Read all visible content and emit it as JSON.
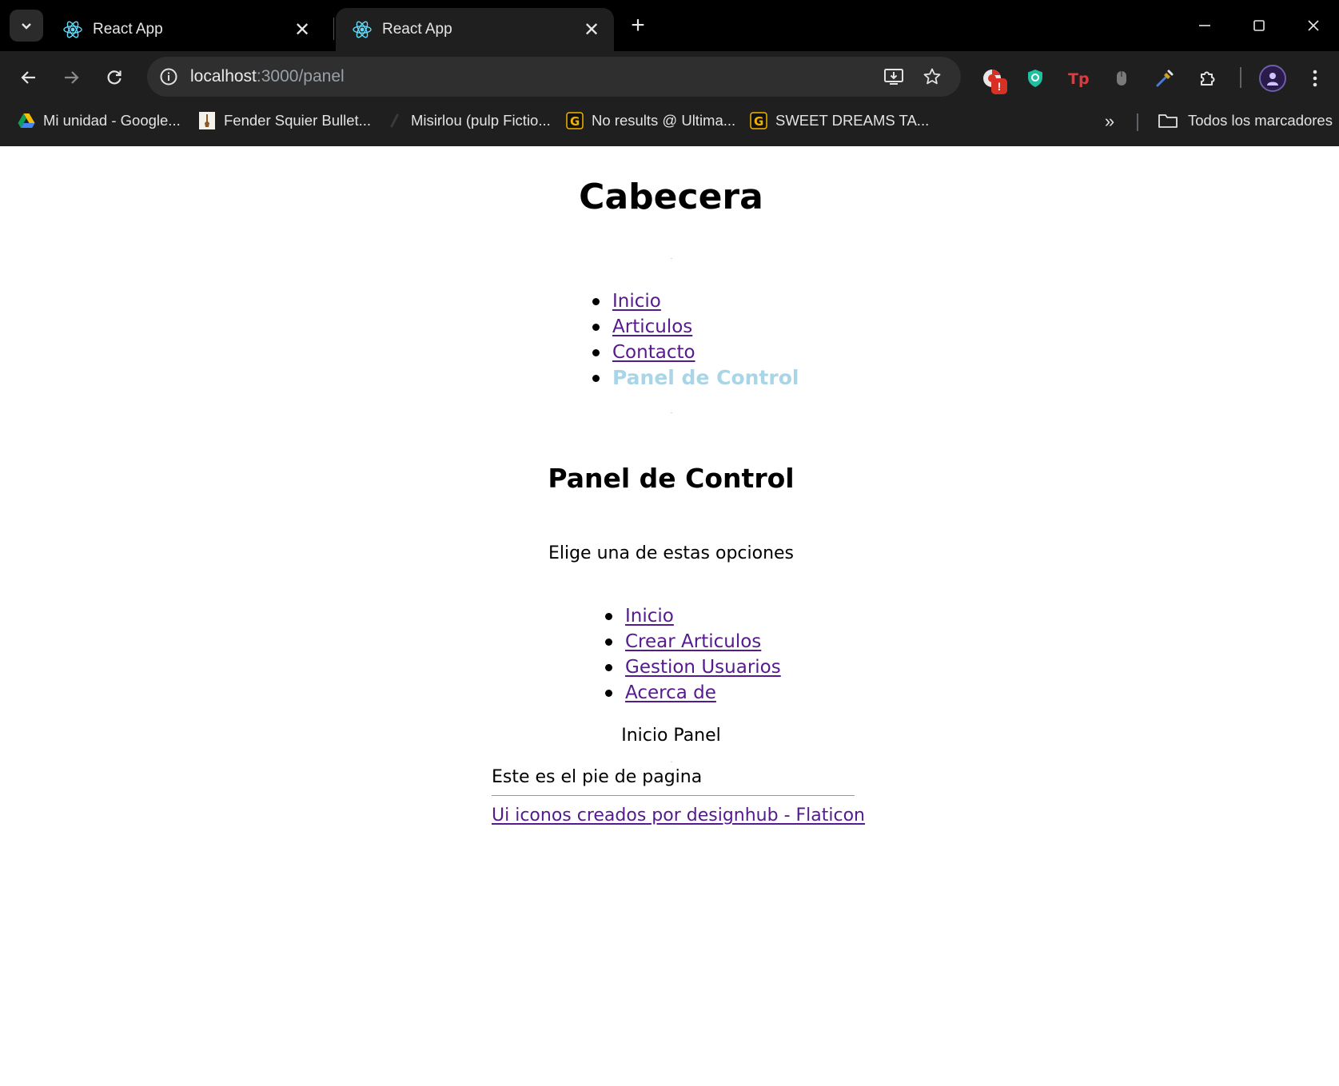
{
  "browser": {
    "tabs": [
      {
        "title": "React App",
        "favicon": "react-icon",
        "active": false
      },
      {
        "title": "React App",
        "favicon": "react-icon",
        "active": true
      }
    ],
    "tab_close": "✕",
    "new_tab": "+",
    "url": {
      "host": "localhost",
      "path": ":3000/panel"
    },
    "bookmarks": [
      {
        "label": "Mi unidad - Google...",
        "icon": "google-drive-icon"
      },
      {
        "label": "Fender Squier Bullet...",
        "icon": "guitar-thumbnail-icon"
      },
      {
        "label": "Misirlou (pulp Fictio...",
        "icon": "music-note-icon"
      },
      {
        "label": "No results @ Ultima...",
        "icon": "ultimate-guitar-icon"
      },
      {
        "label": "SWEET DREAMS TA...",
        "icon": "ultimate-guitar-icon"
      }
    ],
    "bookmarks_more": "»",
    "all_bookmarks": "Todos los marcadores",
    "extension_badge": "!"
  },
  "page": {
    "header_title": "Cabecera",
    "nav": [
      "Inicio",
      "Articulos",
      "Contacto",
      "Panel de Control"
    ],
    "active_nav_color": "#a9d5e6",
    "section_title": "Panel de Control",
    "subtitle": "Elige una de estas opciones",
    "panel_nav": [
      "Inicio",
      "Crear Articulos",
      "Gestion Usuarios",
      "Acerca de"
    ],
    "panel_content": "Inicio Panel",
    "footer_text": "Este es el pie de pagina",
    "footer_link": "Ui iconos creados por designhub - Flaticon",
    "link_color": "#551a8b"
  }
}
